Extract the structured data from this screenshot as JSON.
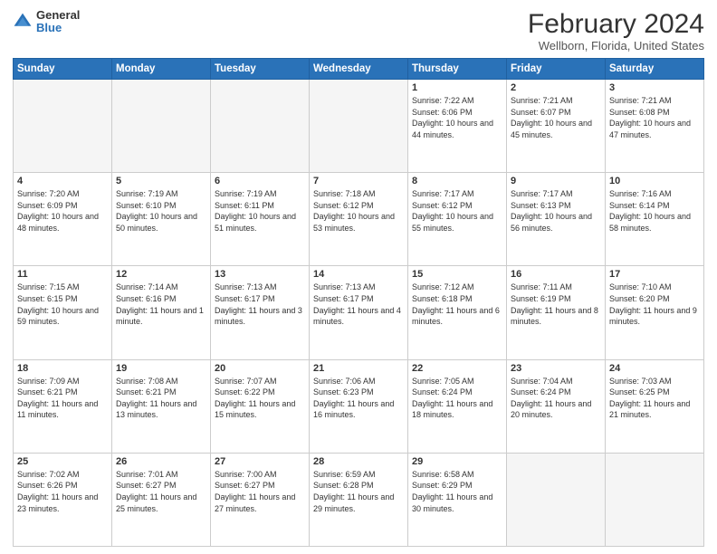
{
  "logo": {
    "general": "General",
    "blue": "Blue"
  },
  "title": "February 2024",
  "subtitle": "Wellborn, Florida, United States",
  "days_of_week": [
    "Sunday",
    "Monday",
    "Tuesday",
    "Wednesday",
    "Thursday",
    "Friday",
    "Saturday"
  ],
  "weeks": [
    [
      {
        "day": "",
        "empty": true
      },
      {
        "day": "",
        "empty": true
      },
      {
        "day": "",
        "empty": true
      },
      {
        "day": "",
        "empty": true
      },
      {
        "day": "1",
        "sunrise": "7:22 AM",
        "sunset": "6:06 PM",
        "daylight": "10 hours and 44 minutes."
      },
      {
        "day": "2",
        "sunrise": "7:21 AM",
        "sunset": "6:07 PM",
        "daylight": "10 hours and 45 minutes."
      },
      {
        "day": "3",
        "sunrise": "7:21 AM",
        "sunset": "6:08 PM",
        "daylight": "10 hours and 47 minutes."
      }
    ],
    [
      {
        "day": "4",
        "sunrise": "7:20 AM",
        "sunset": "6:09 PM",
        "daylight": "10 hours and 48 minutes."
      },
      {
        "day": "5",
        "sunrise": "7:19 AM",
        "sunset": "6:10 PM",
        "daylight": "10 hours and 50 minutes."
      },
      {
        "day": "6",
        "sunrise": "7:19 AM",
        "sunset": "6:11 PM",
        "daylight": "10 hours and 51 minutes."
      },
      {
        "day": "7",
        "sunrise": "7:18 AM",
        "sunset": "6:12 PM",
        "daylight": "10 hours and 53 minutes."
      },
      {
        "day": "8",
        "sunrise": "7:17 AM",
        "sunset": "6:12 PM",
        "daylight": "10 hours and 55 minutes."
      },
      {
        "day": "9",
        "sunrise": "7:17 AM",
        "sunset": "6:13 PM",
        "daylight": "10 hours and 56 minutes."
      },
      {
        "day": "10",
        "sunrise": "7:16 AM",
        "sunset": "6:14 PM",
        "daylight": "10 hours and 58 minutes."
      }
    ],
    [
      {
        "day": "11",
        "sunrise": "7:15 AM",
        "sunset": "6:15 PM",
        "daylight": "10 hours and 59 minutes."
      },
      {
        "day": "12",
        "sunrise": "7:14 AM",
        "sunset": "6:16 PM",
        "daylight": "11 hours and 1 minute."
      },
      {
        "day": "13",
        "sunrise": "7:13 AM",
        "sunset": "6:17 PM",
        "daylight": "11 hours and 3 minutes."
      },
      {
        "day": "14",
        "sunrise": "7:13 AM",
        "sunset": "6:17 PM",
        "daylight": "11 hours and 4 minutes."
      },
      {
        "day": "15",
        "sunrise": "7:12 AM",
        "sunset": "6:18 PM",
        "daylight": "11 hours and 6 minutes."
      },
      {
        "day": "16",
        "sunrise": "7:11 AM",
        "sunset": "6:19 PM",
        "daylight": "11 hours and 8 minutes."
      },
      {
        "day": "17",
        "sunrise": "7:10 AM",
        "sunset": "6:20 PM",
        "daylight": "11 hours and 9 minutes."
      }
    ],
    [
      {
        "day": "18",
        "sunrise": "7:09 AM",
        "sunset": "6:21 PM",
        "daylight": "11 hours and 11 minutes."
      },
      {
        "day": "19",
        "sunrise": "7:08 AM",
        "sunset": "6:21 PM",
        "daylight": "11 hours and 13 minutes."
      },
      {
        "day": "20",
        "sunrise": "7:07 AM",
        "sunset": "6:22 PM",
        "daylight": "11 hours and 15 minutes."
      },
      {
        "day": "21",
        "sunrise": "7:06 AM",
        "sunset": "6:23 PM",
        "daylight": "11 hours and 16 minutes."
      },
      {
        "day": "22",
        "sunrise": "7:05 AM",
        "sunset": "6:24 PM",
        "daylight": "11 hours and 18 minutes."
      },
      {
        "day": "23",
        "sunrise": "7:04 AM",
        "sunset": "6:24 PM",
        "daylight": "11 hours and 20 minutes."
      },
      {
        "day": "24",
        "sunrise": "7:03 AM",
        "sunset": "6:25 PM",
        "daylight": "11 hours and 21 minutes."
      }
    ],
    [
      {
        "day": "25",
        "sunrise": "7:02 AM",
        "sunset": "6:26 PM",
        "daylight": "11 hours and 23 minutes."
      },
      {
        "day": "26",
        "sunrise": "7:01 AM",
        "sunset": "6:27 PM",
        "daylight": "11 hours and 25 minutes."
      },
      {
        "day": "27",
        "sunrise": "7:00 AM",
        "sunset": "6:27 PM",
        "daylight": "11 hours and 27 minutes."
      },
      {
        "day": "28",
        "sunrise": "6:59 AM",
        "sunset": "6:28 PM",
        "daylight": "11 hours and 29 minutes."
      },
      {
        "day": "29",
        "sunrise": "6:58 AM",
        "sunset": "6:29 PM",
        "daylight": "11 hours and 30 minutes."
      },
      {
        "day": "",
        "empty": true
      },
      {
        "day": "",
        "empty": true
      }
    ]
  ],
  "labels": {
    "sunrise": "Sunrise:",
    "sunset": "Sunset:",
    "daylight": "Daylight:"
  }
}
